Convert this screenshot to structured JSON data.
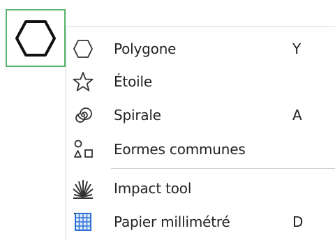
{
  "tool_button": {
    "icon": "hexagon-icon",
    "active": true,
    "accent_color": "#58b56a"
  },
  "flyout_menu": {
    "items": [
      {
        "icon": "hexagon-icon",
        "label": "Polygone",
        "shortcut": "Y"
      },
      {
        "icon": "star-icon",
        "label": "Étoile",
        "shortcut": ""
      },
      {
        "icon": "spiral-icon",
        "label": "Spirale",
        "shortcut": "A"
      },
      {
        "icon": "common-shapes-icon",
        "label": "Eormes communes",
        "shortcut": ""
      },
      {
        "icon": "impact-tool-icon",
        "label": "Impact tool",
        "shortcut": ""
      },
      {
        "icon": "graph-paper-icon",
        "label": "Papier millimétré",
        "shortcut": "D"
      }
    ],
    "graph_paper_color": "#2b6fd6"
  }
}
